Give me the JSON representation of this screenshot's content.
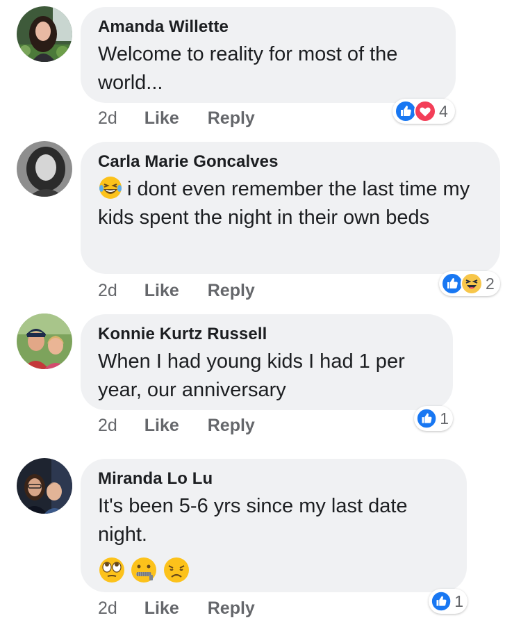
{
  "comments": [
    {
      "author": "Amanda Willette",
      "text": "Welcome to reality for most of the world...",
      "time": "2d",
      "like": "Like",
      "reply": "Reply",
      "reactions": [
        "like-icon",
        "love-icon"
      ],
      "reaction_count": "4"
    },
    {
      "author": "Carla Marie Goncalves",
      "emoji": "laughing-tears-emoji",
      "text": "i dont even remember the last time my kids spent the night in their own beds",
      "time": "2d",
      "like": "Like",
      "reply": "Reply",
      "reactions": [
        "like-icon",
        "haha-icon"
      ],
      "reaction_count": "2"
    },
    {
      "author": "Konnie Kurtz Russell",
      "text": "When I had young kids I had 1 per year, our anniversary",
      "time": "2d",
      "like": "Like",
      "reply": "Reply",
      "reactions": [
        "like-icon"
      ],
      "reaction_count": "1"
    },
    {
      "author": "Miranda Lo Lu",
      "text": "It's been 5-6 yrs since my last date night.",
      "emojis": [
        "eye-roll-emoji",
        "zipper-mouth-emoji",
        "disappointed-emoji"
      ],
      "time": "2d",
      "like": "Like",
      "reply": "Reply",
      "reactions": [
        "like-icon"
      ],
      "reaction_count": "1"
    }
  ],
  "colors": {
    "bubble": "#f0f1f3",
    "like_blue": "#1877f2",
    "love_red": "#f33e58",
    "haha_yellow": "#f7c64a",
    "meta_gray": "#65676b"
  }
}
